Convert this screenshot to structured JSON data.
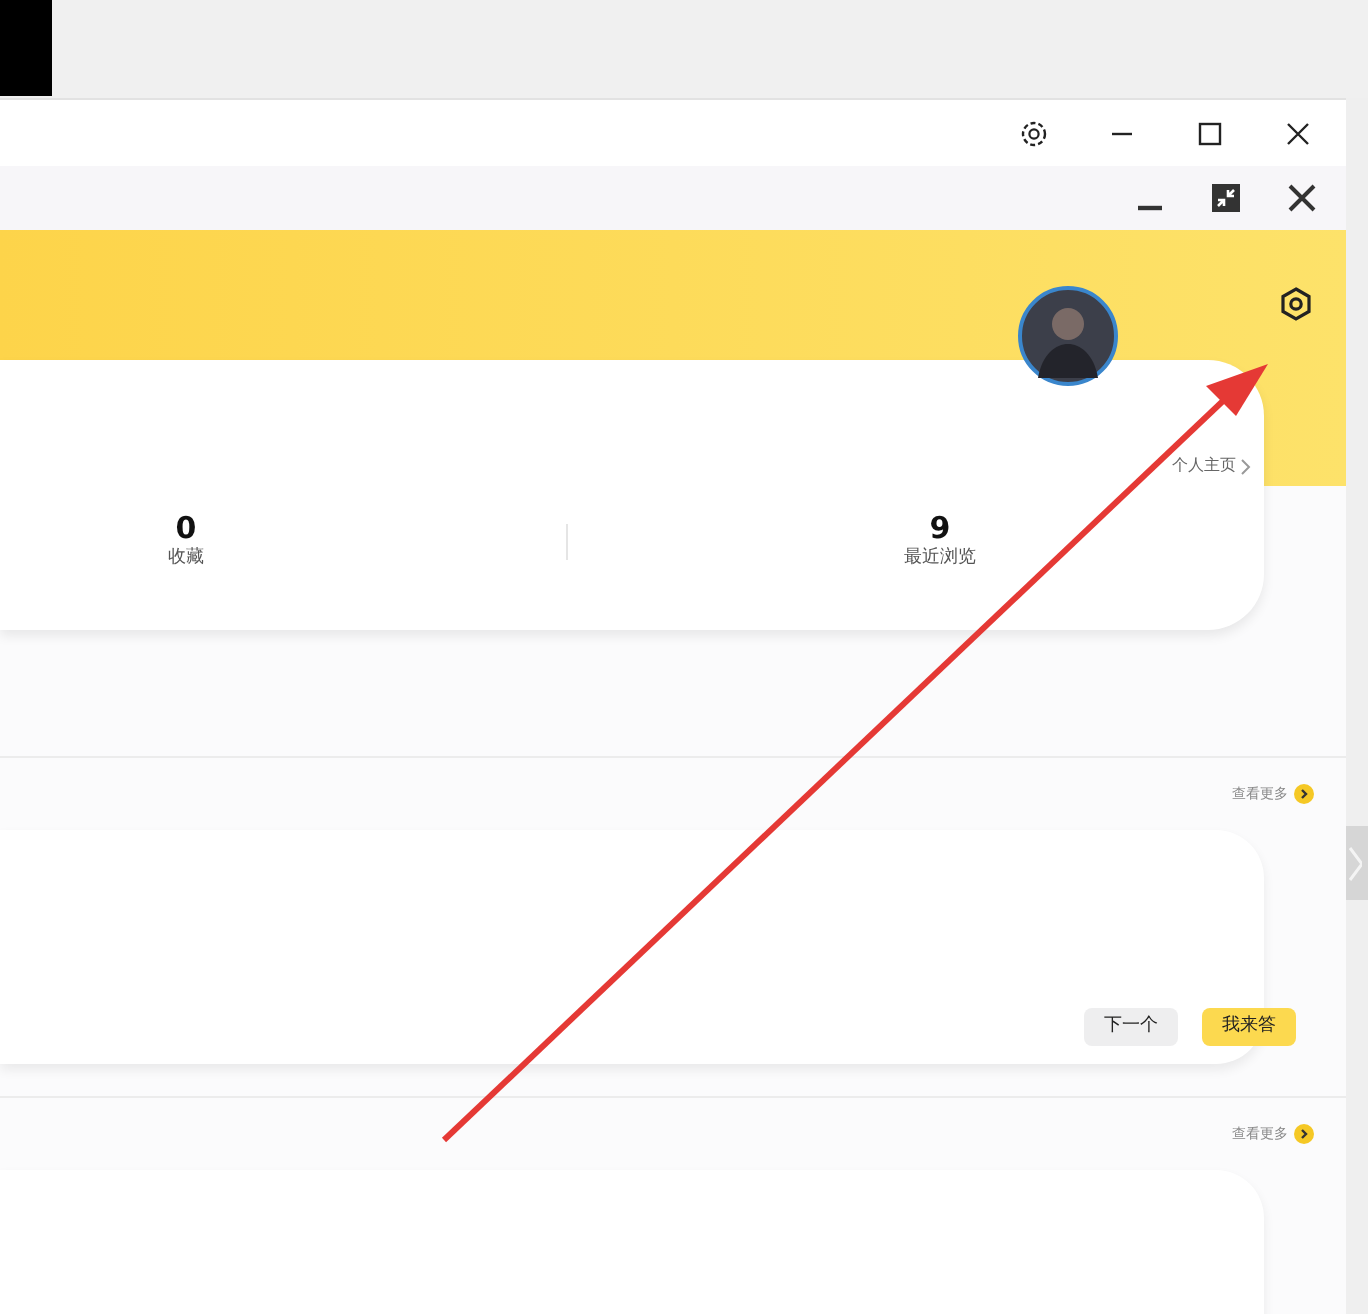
{
  "profile": {
    "link": "个人主页",
    "stats": [
      {
        "value": "0",
        "label": "收藏"
      },
      {
        "value": "9",
        "label": "最近浏览"
      }
    ]
  },
  "sections": [
    {
      "more": "查看更多",
      "buttons": [
        {
          "label": "下一个",
          "kind": "secondary"
        },
        {
          "label": "我来答",
          "kind": "primary"
        }
      ]
    },
    {
      "more": "查看更多"
    }
  ]
}
